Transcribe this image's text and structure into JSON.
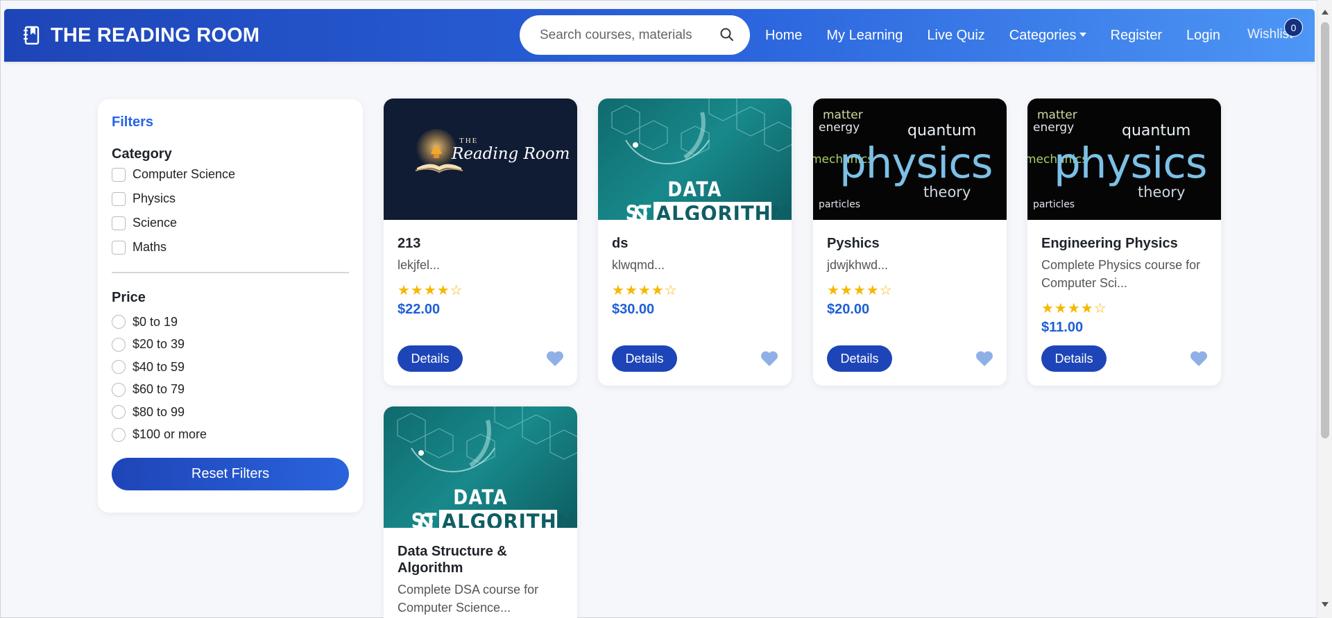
{
  "brand": {
    "title": "THE READING ROOM",
    "icon": "book-icon"
  },
  "search": {
    "placeholder": "Search courses, materials",
    "icon": "search-icon"
  },
  "nav": {
    "home": "Home",
    "my_learning": "My Learning",
    "live_quiz": "Live Quiz",
    "categories": "Categories",
    "register": "Register",
    "login": "Login",
    "wishlist": "Wishlist",
    "wishlist_count": "0"
  },
  "filters": {
    "title": "Filters",
    "category_heading": "Category",
    "categories": [
      "Computer Science",
      "Physics",
      "Science",
      "Maths"
    ],
    "price_heading": "Price",
    "price_ranges": [
      "$0 to 19",
      "$20 to 39",
      "$40 to 59",
      "$60 to 79",
      "$80 to 99",
      "$100 or more"
    ],
    "reset_label": "Reset Filters"
  },
  "courses": [
    {
      "title": "213",
      "description": "lekjfel...",
      "rating": 4,
      "price": "$22.00",
      "details_label": "Details",
      "image": "reading-room-logo"
    },
    {
      "title": "ds",
      "description": "klwqmd...",
      "rating": 4,
      "price": "$30.00",
      "details_label": "Details",
      "image": "data-structures-algorithms"
    },
    {
      "title": "Pyshics",
      "description": "jdwjkhwd...",
      "rating": 4,
      "price": "$20.00",
      "details_label": "Details",
      "image": "physics-word-cloud"
    },
    {
      "title": "Engineering Physics",
      "description": "Complete Physics course for Computer Sci...",
      "rating": 4,
      "price": "$11.00",
      "details_label": "Details",
      "image": "physics-word-cloud"
    },
    {
      "title": "Data Structure & Algorithm",
      "description": "Complete DSA course for Computer Science...",
      "image": "data-structures-algorithms"
    }
  ],
  "thumbnails": {
    "rr_the": "THE",
    "rr_name": "Reading Room",
    "dsa_line1": "DATA STRUCTURES",
    "dsa_amp": "&",
    "dsa_line2": "ALGORITHMS",
    "phys_big": "physics",
    "phys_theory": "theory",
    "phys_words": [
      "matter",
      "energy",
      "quantum",
      "mechanics",
      "particles"
    ]
  },
  "colors": {
    "accent": "#2563eb",
    "brand_dark": "#1e45b8",
    "star": "#f5b800",
    "heart": "#8fb0e6"
  }
}
